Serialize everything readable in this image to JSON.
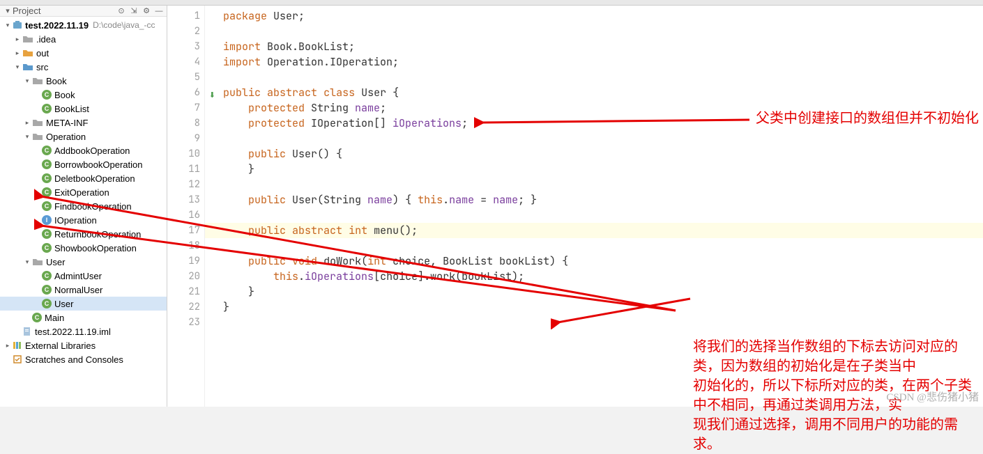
{
  "sidebar": {
    "project_name": "test.2022.11.19",
    "project_path": "D:\\code\\java_-cc",
    "items": [
      {
        "label": ".idea",
        "icon": "folder-gray",
        "indent": 1,
        "chev": "right"
      },
      {
        "label": "out",
        "icon": "folder-orange",
        "indent": 1,
        "chev": "right"
      },
      {
        "label": "src",
        "icon": "folder-blue",
        "indent": 1,
        "chev": "down"
      },
      {
        "label": "Book",
        "icon": "folder-gray",
        "indent": 2,
        "chev": "down"
      },
      {
        "label": "Book",
        "icon": "class",
        "indent": 3
      },
      {
        "label": "BookList",
        "icon": "class",
        "indent": 3
      },
      {
        "label": "META-INF",
        "icon": "folder-gray",
        "indent": 2,
        "chev": "right"
      },
      {
        "label": "Operation",
        "icon": "folder-gray",
        "indent": 2,
        "chev": "down"
      },
      {
        "label": "AddbookOperation",
        "icon": "class",
        "indent": 3
      },
      {
        "label": "BorrowbookOperation",
        "icon": "class",
        "indent": 3
      },
      {
        "label": "DeletbookOperation",
        "icon": "class",
        "indent": 3
      },
      {
        "label": "ExitOperation",
        "icon": "class",
        "indent": 3
      },
      {
        "label": "FindbookOperation",
        "icon": "class",
        "indent": 3
      },
      {
        "label": "IOperation",
        "icon": "interface",
        "indent": 3
      },
      {
        "label": "ReturnbookOperation",
        "icon": "class",
        "indent": 3
      },
      {
        "label": "ShowbookOperation",
        "icon": "class",
        "indent": 3
      },
      {
        "label": "User",
        "icon": "folder-gray",
        "indent": 2,
        "chev": "down"
      },
      {
        "label": "AdmintUser",
        "icon": "class",
        "indent": 3
      },
      {
        "label": "NormalUser",
        "icon": "class",
        "indent": 3
      },
      {
        "label": "User",
        "icon": "class",
        "indent": 3,
        "selected": true
      },
      {
        "label": "Main",
        "icon": "class",
        "indent": 2
      },
      {
        "label": "test.2022.11.19.iml",
        "icon": "file",
        "indent": 1
      }
    ],
    "external_libs": "External Libraries",
    "scratches": "Scratches and Consoles"
  },
  "code": {
    "lines": [
      "package User;",
      "",
      "import Book.BookList;",
      "import Operation.IOperation;",
      "",
      "public abstract class User {",
      "    protected String name;",
      "    protected IOperation[] iOperations;",
      "",
      "    public User() {",
      "    }",
      "",
      "    public User(String name) { this.name = name; }",
      "",
      "",
      "",
      "    public abstract int menu();",
      "",
      "    public void doWork(int choice, BookList bookList) {",
      "        this.iOperations[choice].work(bookList);",
      "    }",
      "}",
      ""
    ],
    "line_numbers": [
      1,
      2,
      3,
      4,
      5,
      6,
      7,
      8,
      9,
      10,
      11,
      12,
      13,
      16,
      17,
      18,
      19,
      20,
      21,
      22,
      23
    ]
  },
  "annotations": {
    "a1": "父类中创建接口的数组但并不初始化",
    "a2_l1": "将我们的选择当作数组的下标去访问对应的类，因为数组的初始化是在子类当中",
    "a2_l2": "初始化的，所以下标所对应的类，在两个子类中不相同，再通过类调用方法，实",
    "a2_l3": "现我们通过选择，调用不同用户的功能的需求。"
  },
  "watermark": "CSDN @悲伤猪小猪"
}
